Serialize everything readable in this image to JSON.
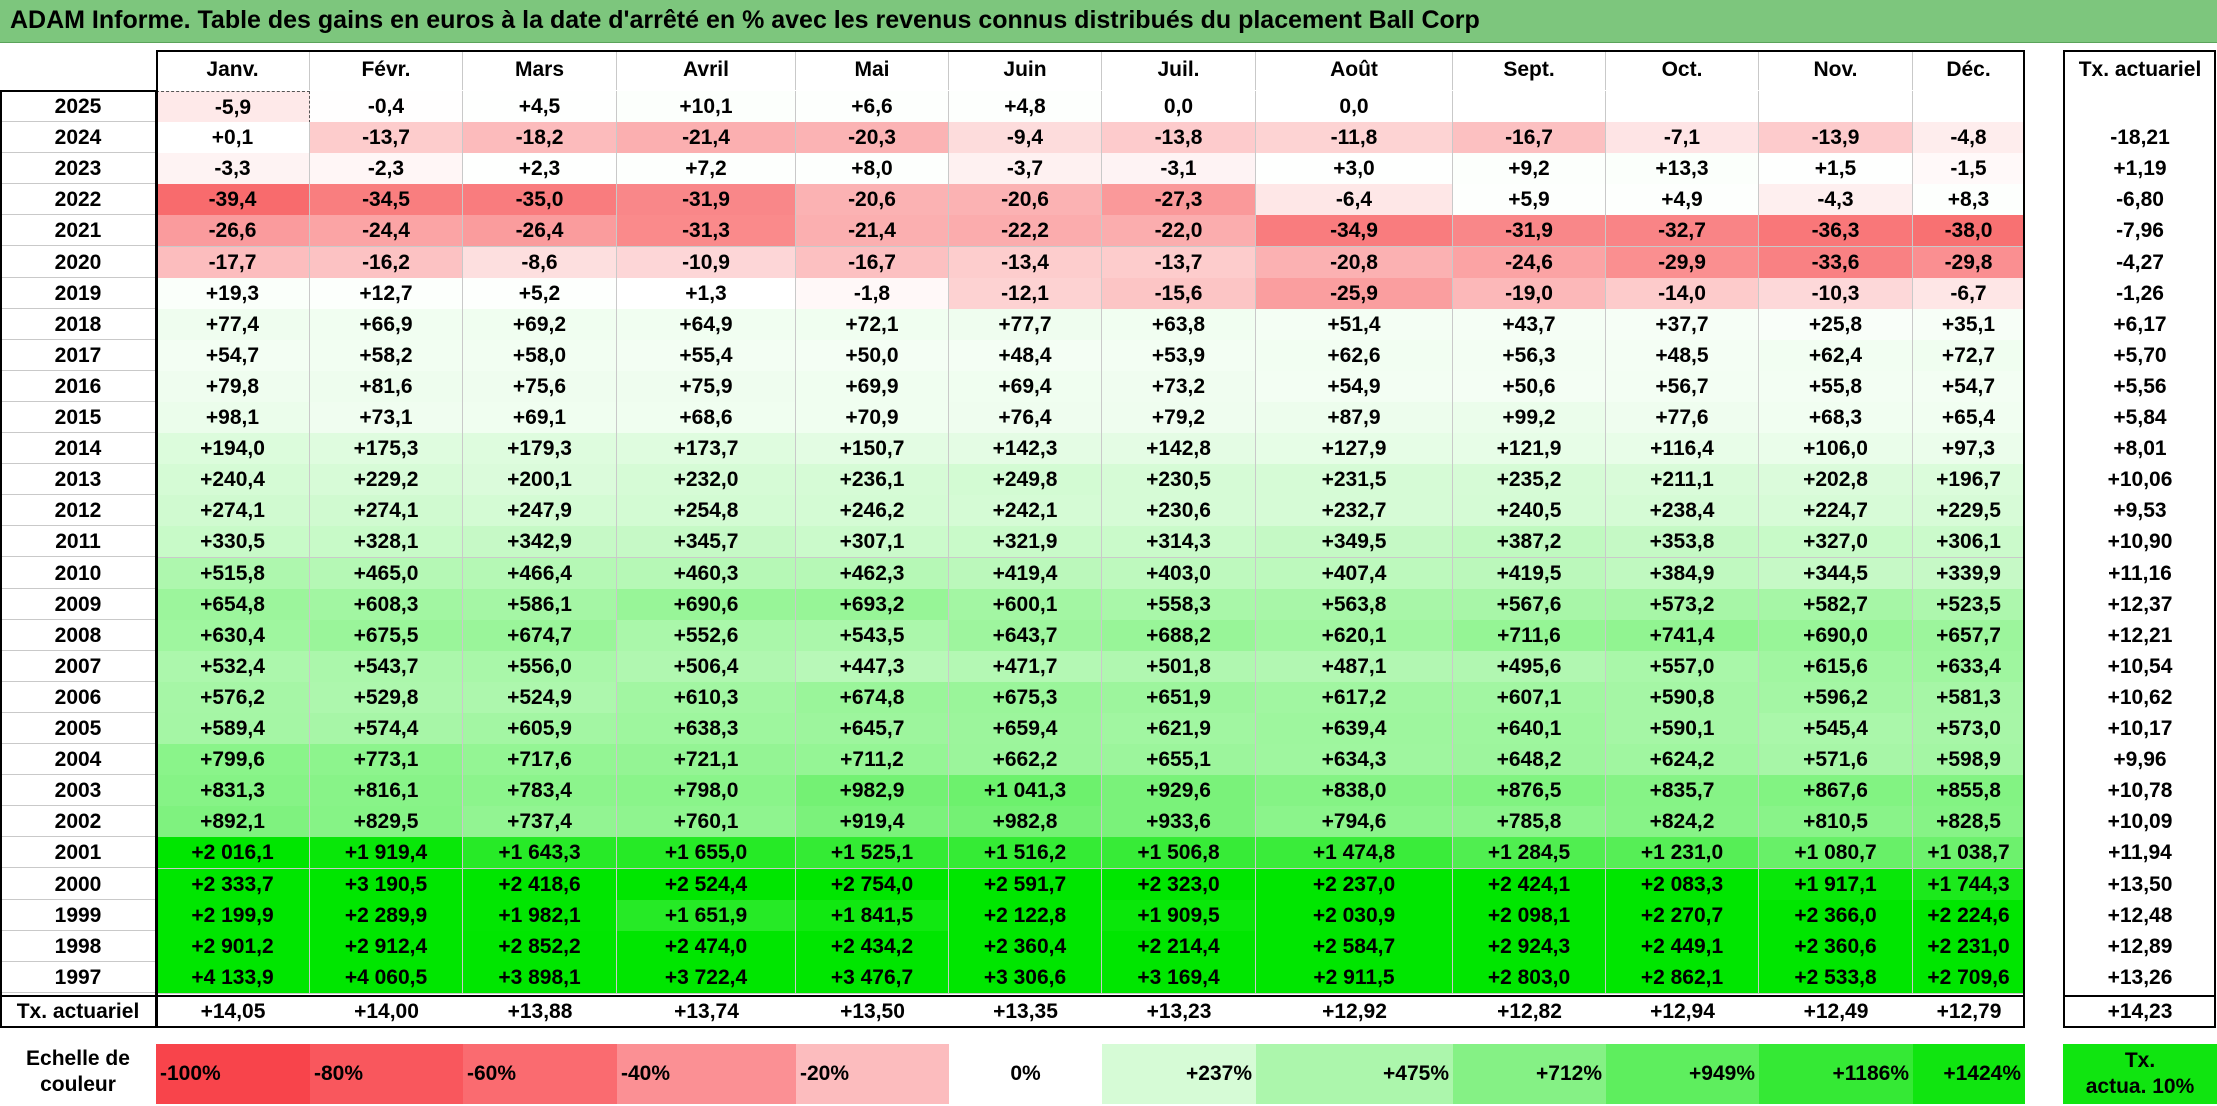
{
  "title": "ADAM Informe. Table des gains en euros à la date d'arrêté en % avec les revenus connus distribués du placement Ball Corp",
  "chart_data": {
    "type": "table",
    "columns": [
      "Janv.",
      "Févr.",
      "Mars",
      "Avril",
      "Mai",
      "Juin",
      "Juil.",
      "Août",
      "Sept.",
      "Oct.",
      "Nov.",
      "Déc."
    ],
    "rate_header": "Tx. actuariel",
    "rows": [
      {
        "year": "2025",
        "values": [
          "-5,9",
          "-0,4",
          "+4,5",
          "+10,1",
          "+6,6",
          "+4,8",
          "0,0",
          "0,0",
          "",
          "",
          "",
          ""
        ],
        "rate": ""
      },
      {
        "year": "2024",
        "values": [
          "+0,1",
          "-13,7",
          "-18,2",
          "-21,4",
          "-20,3",
          "-9,4",
          "-13,8",
          "-11,8",
          "-16,7",
          "-7,1",
          "-13,9",
          "-4,8"
        ],
        "rate": "-18,21"
      },
      {
        "year": "2023",
        "values": [
          "-3,3",
          "-2,3",
          "+2,3",
          "+7,2",
          "+8,0",
          "-3,7",
          "-3,1",
          "+3,0",
          "+9,2",
          "+13,3",
          "+1,5",
          "-1,5"
        ],
        "rate": "+1,19"
      },
      {
        "year": "2022",
        "values": [
          "-39,4",
          "-34,5",
          "-35,0",
          "-31,9",
          "-20,6",
          "-20,6",
          "-27,3",
          "-6,4",
          "+5,9",
          "+4,9",
          "-4,3",
          "+8,3"
        ],
        "rate": "-6,80"
      },
      {
        "year": "2021",
        "values": [
          "-26,6",
          "-24,4",
          "-26,4",
          "-31,3",
          "-21,4",
          "-22,2",
          "-22,0",
          "-34,9",
          "-31,9",
          "-32,7",
          "-36,3",
          "-38,0"
        ],
        "rate": "-7,96"
      },
      {
        "year": "2020",
        "values": [
          "-17,7",
          "-16,2",
          "-8,6",
          "-10,9",
          "-16,7",
          "-13,4",
          "-13,7",
          "-20,8",
          "-24,6",
          "-29,9",
          "-33,6",
          "-29,8"
        ],
        "rate": "-4,27"
      },
      {
        "year": "2019",
        "values": [
          "+19,3",
          "+12,7",
          "+5,2",
          "+1,3",
          "-1,8",
          "-12,1",
          "-15,6",
          "-25,9",
          "-19,0",
          "-14,0",
          "-10,3",
          "-6,7"
        ],
        "rate": "-1,26"
      },
      {
        "year": "2018",
        "values": [
          "+77,4",
          "+66,9",
          "+69,2",
          "+64,9",
          "+72,1",
          "+77,7",
          "+63,8",
          "+51,4",
          "+43,7",
          "+37,7",
          "+25,8",
          "+35,1"
        ],
        "rate": "+6,17"
      },
      {
        "year": "2017",
        "values": [
          "+54,7",
          "+58,2",
          "+58,0",
          "+55,4",
          "+50,0",
          "+48,4",
          "+53,9",
          "+62,6",
          "+56,3",
          "+48,5",
          "+62,4",
          "+72,7"
        ],
        "rate": "+5,70"
      },
      {
        "year": "2016",
        "values": [
          "+79,8",
          "+81,6",
          "+75,6",
          "+75,9",
          "+69,9",
          "+69,4",
          "+73,2",
          "+54,9",
          "+50,6",
          "+56,7",
          "+55,8",
          "+54,7"
        ],
        "rate": "+5,56"
      },
      {
        "year": "2015",
        "values": [
          "+98,1",
          "+73,1",
          "+69,1",
          "+68,6",
          "+70,9",
          "+76,4",
          "+79,2",
          "+87,9",
          "+99,2",
          "+77,6",
          "+68,3",
          "+65,4"
        ],
        "rate": "+5,84"
      },
      {
        "year": "2014",
        "values": [
          "+194,0",
          "+175,3",
          "+179,3",
          "+173,7",
          "+150,7",
          "+142,3",
          "+142,8",
          "+127,9",
          "+121,9",
          "+116,4",
          "+106,0",
          "+97,3"
        ],
        "rate": "+8,01"
      },
      {
        "year": "2013",
        "values": [
          "+240,4",
          "+229,2",
          "+200,1",
          "+232,0",
          "+236,1",
          "+249,8",
          "+230,5",
          "+231,5",
          "+235,2",
          "+211,1",
          "+202,8",
          "+196,7"
        ],
        "rate": "+10,06"
      },
      {
        "year": "2012",
        "values": [
          "+274,1",
          "+274,1",
          "+247,9",
          "+254,8",
          "+246,2",
          "+242,1",
          "+230,6",
          "+232,7",
          "+240,5",
          "+238,4",
          "+224,7",
          "+229,5"
        ],
        "rate": "+9,53"
      },
      {
        "year": "2011",
        "values": [
          "+330,5",
          "+328,1",
          "+342,9",
          "+345,7",
          "+307,1",
          "+321,9",
          "+314,3",
          "+349,5",
          "+387,2",
          "+353,8",
          "+327,0",
          "+306,1"
        ],
        "rate": "+10,90"
      },
      {
        "year": "2010",
        "values": [
          "+515,8",
          "+465,0",
          "+466,4",
          "+460,3",
          "+462,3",
          "+419,4",
          "+403,0",
          "+407,4",
          "+419,5",
          "+384,9",
          "+344,5",
          "+339,9"
        ],
        "rate": "+11,16"
      },
      {
        "year": "2009",
        "values": [
          "+654,8",
          "+608,3",
          "+586,1",
          "+690,6",
          "+693,2",
          "+600,1",
          "+558,3",
          "+563,8",
          "+567,6",
          "+573,2",
          "+582,7",
          "+523,5"
        ],
        "rate": "+12,37"
      },
      {
        "year": "2008",
        "values": [
          "+630,4",
          "+675,5",
          "+674,7",
          "+552,6",
          "+543,5",
          "+643,7",
          "+688,2",
          "+620,1",
          "+711,6",
          "+741,4",
          "+690,0",
          "+657,7"
        ],
        "rate": "+12,21"
      },
      {
        "year": "2007",
        "values": [
          "+532,4",
          "+543,7",
          "+556,0",
          "+506,4",
          "+447,3",
          "+471,7",
          "+501,8",
          "+487,1",
          "+495,6",
          "+557,0",
          "+615,6",
          "+633,4"
        ],
        "rate": "+10,54"
      },
      {
        "year": "2006",
        "values": [
          "+576,2",
          "+529,8",
          "+524,9",
          "+610,3",
          "+674,8",
          "+675,3",
          "+651,9",
          "+617,2",
          "+607,1",
          "+590,8",
          "+596,2",
          "+581,3"
        ],
        "rate": "+10,62"
      },
      {
        "year": "2005",
        "values": [
          "+589,4",
          "+574,4",
          "+605,9",
          "+638,3",
          "+645,7",
          "+659,4",
          "+621,9",
          "+639,4",
          "+640,1",
          "+590,1",
          "+545,4",
          "+573,0"
        ],
        "rate": "+10,17"
      },
      {
        "year": "2004",
        "values": [
          "+799,6",
          "+773,1",
          "+717,6",
          "+721,1",
          "+711,2",
          "+662,2",
          "+655,1",
          "+634,3",
          "+648,2",
          "+624,2",
          "+571,6",
          "+598,9"
        ],
        "rate": "+9,96"
      },
      {
        "year": "2003",
        "values": [
          "+831,3",
          "+816,1",
          "+783,4",
          "+798,0",
          "+982,9",
          "+1 041,3",
          "+929,6",
          "+838,0",
          "+876,5",
          "+835,7",
          "+867,6",
          "+855,8"
        ],
        "rate": "+10,78"
      },
      {
        "year": "2002",
        "values": [
          "+892,1",
          "+829,5",
          "+737,4",
          "+760,1",
          "+919,4",
          "+982,8",
          "+933,6",
          "+794,6",
          "+785,8",
          "+824,2",
          "+810,5",
          "+828,5"
        ],
        "rate": "+10,09"
      },
      {
        "year": "2001",
        "values": [
          "+2 016,1",
          "+1 919,4",
          "+1 643,3",
          "+1 655,0",
          "+1 525,1",
          "+1 516,2",
          "+1 506,8",
          "+1 474,8",
          "+1 284,5",
          "+1 231,0",
          "+1 080,7",
          "+1 038,7"
        ],
        "rate": "+11,94"
      },
      {
        "year": "2000",
        "values": [
          "+2 333,7",
          "+3 190,5",
          "+2 418,6",
          "+2 524,4",
          "+2 754,0",
          "+2 591,7",
          "+2 323,0",
          "+2 237,0",
          "+2 424,1",
          "+2 083,3",
          "+1 917,1",
          "+1 744,3"
        ],
        "rate": "+13,50"
      },
      {
        "year": "1999",
        "values": [
          "+2 199,9",
          "+2 289,9",
          "+1 982,1",
          "+1 651,9",
          "+1 841,5",
          "+2 122,8",
          "+1 909,5",
          "+2 030,9",
          "+2 098,1",
          "+2 270,7",
          "+2 366,0",
          "+2 224,6"
        ],
        "rate": "+12,48"
      },
      {
        "year": "1998",
        "values": [
          "+2 901,2",
          "+2 912,4",
          "+2 852,2",
          "+2 474,0",
          "+2 434,2",
          "+2 360,4",
          "+2 214,4",
          "+2 584,7",
          "+2 924,3",
          "+2 449,1",
          "+2 360,6",
          "+2 231,0"
        ],
        "rate": "+12,89"
      },
      {
        "year": "1997",
        "values": [
          "+4 133,9",
          "+4 060,5",
          "+3 898,1",
          "+3 722,4",
          "+3 476,7",
          "+3 306,6",
          "+3 169,4",
          "+2 911,5",
          "+2 803,0",
          "+2 862,1",
          "+2 533,8",
          "+2 709,6"
        ],
        "rate": "+13,26"
      }
    ],
    "footer": {
      "label": "Tx. actuariel",
      "values": [
        "+14,05",
        "+14,00",
        "+13,88",
        "+13,74",
        "+13,50",
        "+13,35",
        "+13,23",
        "+12,92",
        "+12,82",
        "+12,94",
        "+12,49",
        "+12,79"
      ],
      "rate": "+14,23"
    },
    "scale": {
      "label_line1": "Echelle de",
      "label_line2": "couleur",
      "entries": [
        {
          "text": "-100%",
          "color": "#f8444b"
        },
        {
          "text": "-80%",
          "color": "#f9575d"
        },
        {
          "text": "-60%",
          "color": "#fa6b70"
        },
        {
          "text": "-40%",
          "color": "#fb9094"
        },
        {
          "text": "-20%",
          "color": "#fcbcbe"
        },
        {
          "text": "0%",
          "color": "#ffffff"
        },
        {
          "text": "+237%",
          "color": "#d6fbd6"
        },
        {
          "text": "+475%",
          "color": "#acf6ac"
        },
        {
          "text": "+712%",
          "color": "#85f185"
        },
        {
          "text": "+949%",
          "color": "#5eee5e"
        },
        {
          "text": "+1186%",
          "color": "#35e935"
        },
        {
          "text": "+1424%",
          "color": "#10e510"
        }
      ],
      "rate_line1": "Tx.",
      "rate_line2": "actua. 10%",
      "rate_color": "#10e510"
    }
  }
}
